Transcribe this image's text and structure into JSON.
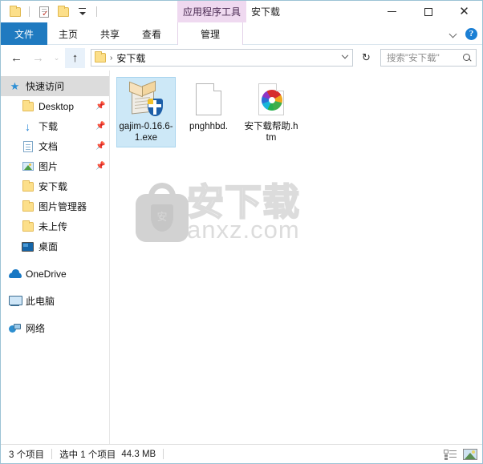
{
  "window": {
    "title": "安下载",
    "contextual_tab_group": "应用程序工具",
    "minimize_label": "最小化",
    "maximize_label": "最大化",
    "close_label": "关闭"
  },
  "quick_access_toolbar": {
    "items": [
      {
        "name": "folder-icon",
        "label": ""
      },
      {
        "name": "properties-icon",
        "label": ""
      },
      {
        "name": "new-folder-icon",
        "label": ""
      },
      {
        "name": "customize-chevron-icon",
        "label": ""
      }
    ]
  },
  "ribbon": {
    "tabs": [
      {
        "label": "文件",
        "active": true
      },
      {
        "label": "主页",
        "active": false
      },
      {
        "label": "共享",
        "active": false
      },
      {
        "label": "查看",
        "active": false
      }
    ],
    "contextual_tab": "管理",
    "collapse_label": "",
    "help_label": "?",
    "accent_color": "#1f7ac0",
    "contextual_color": "#efd9f0"
  },
  "navigation": {
    "back_label": "←",
    "forward_label": "→",
    "recent_label": "⌄",
    "up_label": "↑",
    "breadcrumb": "安下载",
    "breadcrumb_chevron": "›",
    "refresh_label": "↻"
  },
  "search": {
    "placeholder": "搜索\"安下载\""
  },
  "sidebar": {
    "items": [
      {
        "label": "快速访问",
        "icon": "star-icon",
        "level": 0,
        "selected": true,
        "pinned": false
      },
      {
        "label": "Desktop",
        "icon": "folder-icon",
        "level": 1,
        "selected": false,
        "pinned": true
      },
      {
        "label": "下载",
        "icon": "download-icon",
        "level": 1,
        "selected": false,
        "pinned": true
      },
      {
        "label": "文档",
        "icon": "document-icon",
        "level": 1,
        "selected": false,
        "pinned": true
      },
      {
        "label": "图片",
        "icon": "picture-icon",
        "level": 1,
        "selected": false,
        "pinned": true
      },
      {
        "label": "安下载",
        "icon": "folder-icon",
        "level": 1,
        "selected": false,
        "pinned": false
      },
      {
        "label": "图片管理器",
        "icon": "folder-icon",
        "level": 1,
        "selected": false,
        "pinned": false
      },
      {
        "label": "未上传",
        "icon": "folder-icon",
        "level": 1,
        "selected": false,
        "pinned": false
      },
      {
        "label": "桌面",
        "icon": "desktop-icon",
        "level": 1,
        "selected": false,
        "pinned": false
      },
      {
        "label": "OneDrive",
        "icon": "cloud-icon",
        "level": 0,
        "selected": false,
        "pinned": false
      },
      {
        "label": "此电脑",
        "icon": "computer-icon",
        "level": 0,
        "selected": false,
        "pinned": false
      },
      {
        "label": "网络",
        "icon": "network-icon",
        "level": 0,
        "selected": false,
        "pinned": false
      }
    ],
    "pin_glyph": "📌"
  },
  "files": [
    {
      "name": "gajim-0.16.6-1.exe",
      "icon": "installer-package-icon",
      "selected": true
    },
    {
      "name": "pnghhbd.",
      "icon": "blank-document-icon",
      "selected": false
    },
    {
      "name": "安下载帮助.htm",
      "icon": "html-document-icon",
      "selected": false
    }
  ],
  "watermark": {
    "logo_char": "安",
    "chinese": "安下载",
    "domain": "anxz.com"
  },
  "statusbar": {
    "item_count": "3 个项目",
    "selection": "选中 1 个项目",
    "selection_size": "44.3 MB",
    "view_details_label": "详细信息",
    "view_large_icons_label": "大图标"
  }
}
